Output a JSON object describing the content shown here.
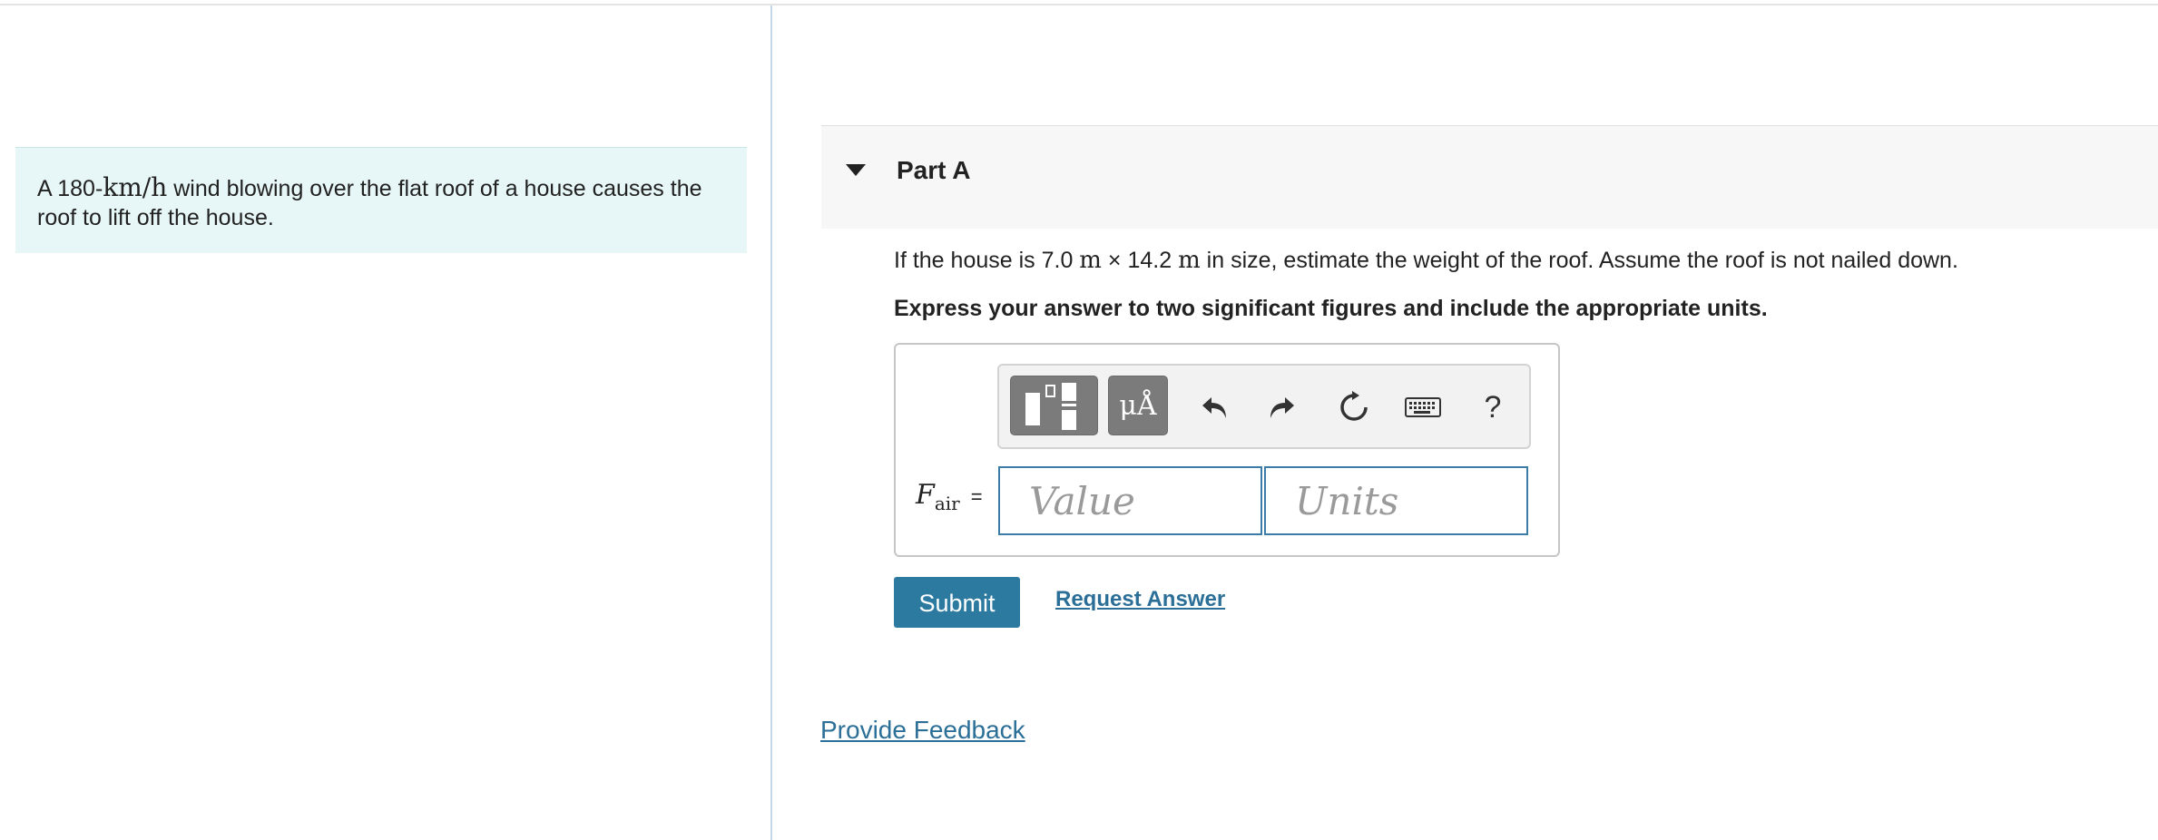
{
  "intro": {
    "text_a": "A 180-",
    "unit": "km/h",
    "text_b": " wind blowing over the flat roof of a house causes the roof to lift off the house."
  },
  "part": {
    "title": "Part A"
  },
  "question": {
    "pre": "If the house is 7.0 ",
    "u1": "m",
    "times": " × ",
    "mid": "14.2 ",
    "u2": "m",
    "post": " in size, estimate the weight of the roof. Assume the roof is not nailed down."
  },
  "instruction": "Express your answer to two significant figures and include the appropriate units.",
  "toolbar": {
    "units_label": "μÅ",
    "help_label": "?",
    "icons": [
      "templates-icon",
      "units-icon",
      "undo-icon",
      "redo-icon",
      "reset-icon",
      "keyboard-icon",
      "help-icon"
    ]
  },
  "answer": {
    "var_main": "F",
    "var_sub": "air",
    "equals": "=",
    "value_placeholder": "Value",
    "units_placeholder": "Units"
  },
  "actions": {
    "submit_label": "Submit",
    "request_label": "Request Answer"
  },
  "footer": {
    "feedback_label": "Provide Feedback"
  },
  "colors": {
    "intro_bg": "#e7f6f6",
    "accent": "#2d7aa0",
    "link": "#2b6f98",
    "toolbar_button": "#7b7b7b"
  }
}
